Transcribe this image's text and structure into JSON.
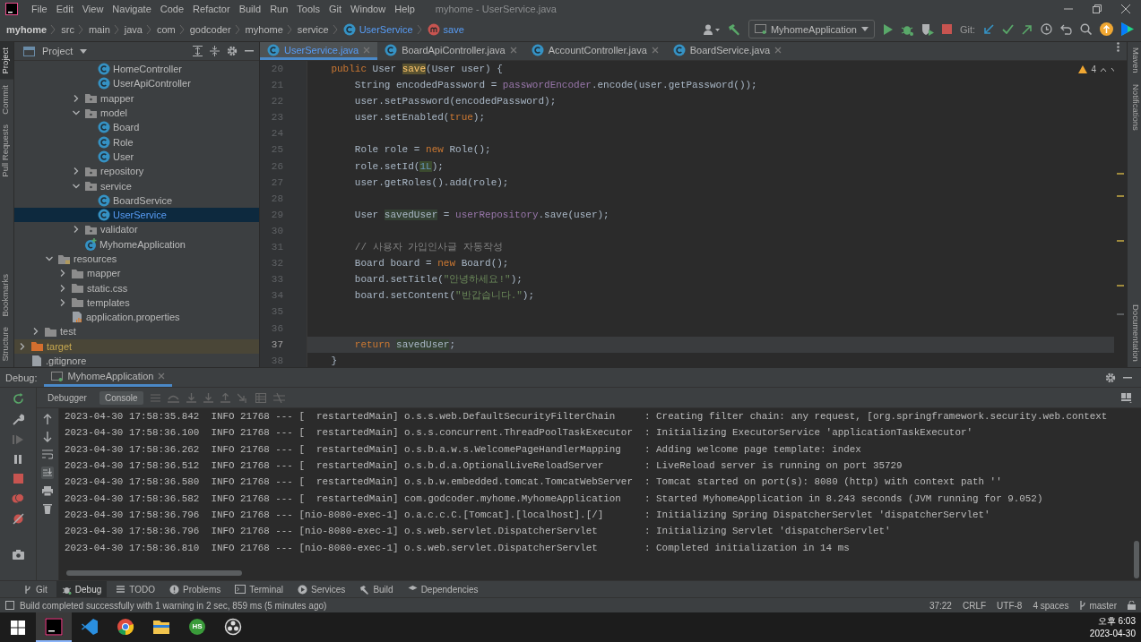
{
  "window": {
    "title": "myhome - UserService.java"
  },
  "menu": [
    "File",
    "Edit",
    "View",
    "Navigate",
    "Code",
    "Refactor",
    "Build",
    "Run",
    "Tools",
    "Git",
    "Window",
    "Help"
  ],
  "breadcrumbs": [
    {
      "label": "myhome",
      "kind": "root"
    },
    {
      "label": "src",
      "kind": "dir"
    },
    {
      "label": "main",
      "kind": "dir"
    },
    {
      "label": "java",
      "kind": "dir"
    },
    {
      "label": "com",
      "kind": "dir"
    },
    {
      "label": "godcoder",
      "kind": "dir"
    },
    {
      "label": "myhome",
      "kind": "dir"
    },
    {
      "label": "service",
      "kind": "dir"
    },
    {
      "label": "UserService",
      "kind": "class"
    },
    {
      "label": "save",
      "kind": "method"
    }
  ],
  "toolbar": {
    "run_config": "MyhomeApplication",
    "git_label": "Git:"
  },
  "left_strip": {
    "top": [
      {
        "label": "Project",
        "selected": true
      },
      {
        "label": "Commit",
        "selected": false
      },
      {
        "label": "Pull Requests",
        "selected": false
      }
    ],
    "bottom": [
      {
        "label": "Bookmarks",
        "selected": false
      },
      {
        "label": "Structure",
        "selected": false
      }
    ]
  },
  "right_strip": {
    "top": [
      "Maven",
      "Notifications"
    ],
    "bottom": [
      "Documentation"
    ]
  },
  "project": {
    "title": "Project",
    "tree": [
      {
        "children": [
          {
            "children": [
              {
                "children": [
                  {
                    "children": [
                      {
                        "children": [
                          {
                            "label": "HomeController",
                            "kind": "class",
                            "selected": false
                          },
                          {
                            "label": "UserApiController",
                            "kind": "class",
                            "selected": false
                          }
                        ]
                      },
                      {
                        "label": "mapper",
                        "kind": "package",
                        "expanded": false,
                        "selected": false
                      },
                      {
                        "label": "model",
                        "kind": "package",
                        "expanded": true,
                        "selected": false,
                        "children": [
                          {
                            "label": "Board",
                            "kind": "class",
                            "selected": false
                          },
                          {
                            "label": "Role",
                            "kind": "class",
                            "selected": false
                          },
                          {
                            "label": "User",
                            "kind": "class",
                            "selected": false
                          }
                        ]
                      },
                      {
                        "label": "repository",
                        "kind": "package",
                        "expanded": false,
                        "selected": false
                      },
                      {
                        "label": "service",
                        "kind": "package",
                        "expanded": true,
                        "selected": false,
                        "children": [
                          {
                            "label": "BoardService",
                            "kind": "class",
                            "selected": false
                          },
                          {
                            "label": "UserService",
                            "kind": "class",
                            "selected": true
                          }
                        ]
                      },
                      {
                        "label": "validator",
                        "kind": "package",
                        "expanded": false,
                        "selected": false
                      },
                      {
                        "label": "MyhomeApplication",
                        "kind": "app",
                        "selected": false
                      }
                    ]
                  }
                ]
              },
              {
                "label": "resources",
                "kind": "resources",
                "expanded": true,
                "selected": false,
                "children": [
                  {
                    "label": "mapper",
                    "kind": "folder",
                    "expanded": false,
                    "selected": false
                  },
                  {
                    "label": "static.css",
                    "kind": "folder",
                    "expanded": false,
                    "selected": false
                  },
                  {
                    "label": "templates",
                    "kind": "folder",
                    "expanded": false,
                    "selected": false
                  },
                  {
                    "label": "application.properties",
                    "kind": "props",
                    "selected": false
                  }
                ]
              }
            ]
          },
          {
            "label": "test",
            "kind": "folder",
            "expanded": false,
            "selected": false
          }
        ]
      },
      {
        "label": "target",
        "kind": "excluded",
        "expanded": false,
        "selected": false
      },
      {
        "label": ".gitignore",
        "kind": "file",
        "selected": false
      }
    ]
  },
  "editor": {
    "tabs": [
      {
        "label": "UserService.java",
        "selected": true
      },
      {
        "label": "BoardApiController.java",
        "selected": false
      },
      {
        "label": "AccountController.java",
        "selected": false
      },
      {
        "label": "BoardService.java",
        "selected": false
      }
    ],
    "warnings": "4",
    "lines": [
      {
        "number": "20",
        "current": false,
        "tokens": [
          {
            "kind": "kw",
            "t": "    public"
          },
          {
            "kind": "plain",
            "t": " User "
          },
          {
            "kind": "decl",
            "t": "save"
          },
          {
            "kind": "plain",
            "t": "(User user) {"
          }
        ]
      },
      {
        "number": "21",
        "current": false,
        "tokens": [
          {
            "kind": "plain",
            "t": "        String encodedPassword = "
          },
          {
            "kind": "field",
            "t": "passwordEncoder"
          },
          {
            "kind": "plain",
            "t": ".encode(user.getPassword());"
          }
        ]
      },
      {
        "number": "22",
        "current": false,
        "tokens": [
          {
            "kind": "plain",
            "t": "        user.setPassword(encodedPassword);"
          }
        ]
      },
      {
        "number": "23",
        "current": false,
        "tokens": [
          {
            "kind": "plain",
            "t": "        user.setEnabled("
          },
          {
            "kind": "kw",
            "t": "true"
          },
          {
            "kind": "plain",
            "t": ");"
          }
        ]
      },
      {
        "number": "24",
        "current": false
      },
      {
        "number": "25",
        "current": false,
        "tokens": [
          {
            "kind": "plain",
            "t": "        Role role = "
          },
          {
            "kind": "kw",
            "t": "new"
          },
          {
            "kind": "plain",
            "t": " Role();"
          }
        ]
      },
      {
        "number": "26",
        "current": false,
        "tokens": [
          {
            "kind": "plain",
            "t": "        role.setId("
          },
          {
            "kind": "numref",
            "t": "1L"
          },
          {
            "kind": "plain",
            "t": ");"
          }
        ]
      },
      {
        "number": "27",
        "current": false,
        "tokens": [
          {
            "kind": "plain",
            "t": "        user.getRoles().add(role);"
          }
        ]
      },
      {
        "number": "28",
        "current": false
      },
      {
        "number": "29",
        "current": false,
        "tokens": [
          {
            "kind": "plain",
            "t": "        User "
          },
          {
            "kind": "ref",
            "t": "savedUser"
          },
          {
            "kind": "plain",
            "t": " = "
          },
          {
            "kind": "field",
            "t": "userRepository"
          },
          {
            "kind": "plain",
            "t": ".save(user);"
          }
        ]
      },
      {
        "number": "30",
        "current": false
      },
      {
        "number": "31",
        "current": false,
        "tokens": [
          {
            "kind": "comment",
            "t": "        // 사용자 가입인사글 자동작성"
          }
        ]
      },
      {
        "number": "32",
        "current": false,
        "tokens": [
          {
            "kind": "plain",
            "t": "        Board board = "
          },
          {
            "kind": "kw",
            "t": "new"
          },
          {
            "kind": "plain",
            "t": " Board();"
          }
        ]
      },
      {
        "number": "33",
        "current": false,
        "tokens": [
          {
            "kind": "plain",
            "t": "        board.setTitle("
          },
          {
            "kind": "str",
            "t": "\"안녕하세요!\""
          },
          {
            "kind": "plain",
            "t": ");"
          }
        ]
      },
      {
        "number": "34",
        "current": false,
        "tokens": [
          {
            "kind": "plain",
            "t": "        board.setContent("
          },
          {
            "kind": "str",
            "t": "\"반갑습니다.\""
          },
          {
            "kind": "plain",
            "t": ");"
          }
        ]
      },
      {
        "number": "35",
        "current": false
      },
      {
        "number": "36",
        "current": false
      },
      {
        "number": "37",
        "current": true,
        "tokens": [
          {
            "kind": "kw",
            "t": "        return "
          },
          {
            "kind": "ref",
            "t": "savedUser"
          },
          {
            "kind": "plain",
            "t": ";"
          }
        ]
      },
      {
        "number": "38",
        "current": false,
        "tokens": [
          {
            "kind": "plain",
            "t": "    }"
          }
        ]
      }
    ]
  },
  "debug": {
    "label": "Debug:",
    "session": "MyhomeApplication",
    "tabs": [
      {
        "label": "Debugger",
        "selected": false
      },
      {
        "label": "Console",
        "selected": true
      }
    ],
    "console": [
      "2023-04-30 17:58:35.842  INFO 21768 --- [  restartedMain] o.s.s.web.DefaultSecurityFilterChain     : Creating filter chain: any request, [org.springframework.security.web.context",
      "2023-04-30 17:58:36.100  INFO 21768 --- [  restartedMain] o.s.s.concurrent.ThreadPoolTaskExecutor  : Initializing ExecutorService 'applicationTaskExecutor'",
      "2023-04-30 17:58:36.262  INFO 21768 --- [  restartedMain] o.s.b.a.w.s.WelcomePageHandlerMapping    : Adding welcome page template: index",
      "2023-04-30 17:58:36.512  INFO 21768 --- [  restartedMain] o.s.b.d.a.OptionalLiveReloadServer       : LiveReload server is running on port 35729",
      "2023-04-30 17:58:36.580  INFO 21768 --- [  restartedMain] o.s.b.w.embedded.tomcat.TomcatWebServer  : Tomcat started on port(s): 8080 (http) with context path ''",
      "2023-04-30 17:58:36.582  INFO 21768 --- [  restartedMain] com.godcoder.myhome.MyhomeApplication    : Started MyhomeApplication in 8.243 seconds (JVM running for 9.052)",
      "2023-04-30 17:58:36.796  INFO 21768 --- [nio-8080-exec-1] o.a.c.c.C.[Tomcat].[localhost].[/]       : Initializing Spring DispatcherServlet 'dispatcherServlet'",
      "2023-04-30 17:58:36.796  INFO 21768 --- [nio-8080-exec-1] o.s.web.servlet.DispatcherServlet        : Initializing Servlet 'dispatcherServlet'",
      "2023-04-30 17:58:36.810  INFO 21768 --- [nio-8080-exec-1] o.s.web.servlet.DispatcherServlet        : Completed initialization in 14 ms"
    ]
  },
  "tool_windows": [
    {
      "label": "Git",
      "kind": "git",
      "selected": false
    },
    {
      "label": "Debug",
      "kind": "debug",
      "selected": true
    },
    {
      "label": "TODO",
      "kind": "todo",
      "selected": false
    },
    {
      "label": "Problems",
      "kind": "problems",
      "selected": false
    },
    {
      "label": "Terminal",
      "kind": "terminal",
      "selected": false
    },
    {
      "label": "Services",
      "kind": "services",
      "selected": false
    },
    {
      "label": "Build",
      "kind": "build",
      "selected": false
    },
    {
      "label": "Dependencies",
      "kind": "dependencies",
      "selected": false
    }
  ],
  "status": {
    "message": "Build completed successfully with 1 warning in 2 sec, 859 ms (5 minutes ago)",
    "position": "37:22",
    "line_separator": "CRLF",
    "encoding": "UTF-8",
    "indent": "4 spaces",
    "branch": "master"
  },
  "taskbar": {
    "apps": [
      {
        "kind": "intellij",
        "selected": true
      },
      {
        "kind": "vscode",
        "selected": false
      },
      {
        "kind": "chrome",
        "selected": false
      },
      {
        "kind": "explorer",
        "selected": false
      },
      {
        "kind": "hs",
        "label": "HS",
        "selected": false
      },
      {
        "kind": "obs",
        "selected": false
      }
    ],
    "time": "오후 6:03",
    "date": "2023-04-30"
  }
}
